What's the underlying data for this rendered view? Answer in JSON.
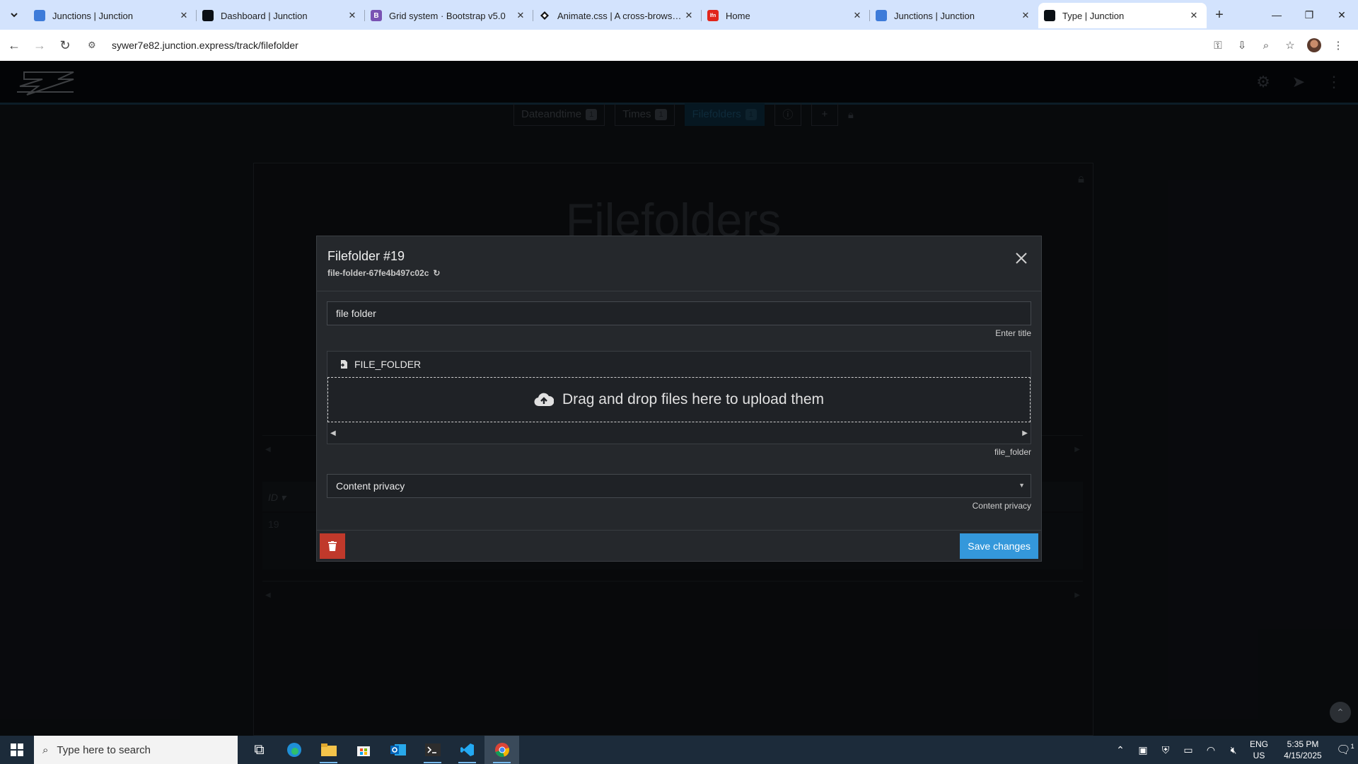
{
  "browser": {
    "tabs": [
      {
        "title": "Junctions | Junction",
        "fav_color": "#3d7bd9",
        "fav": ""
      },
      {
        "title": "Dashboard | Junction",
        "fav_color": "#0a0f14",
        "fav": ""
      },
      {
        "title": "Grid system · Bootstrap v5.0",
        "fav_color": "#7952b3",
        "fav": "B"
      },
      {
        "title": "Animate.css | A cross-browser library of CSS animations",
        "fav_color": "#111111",
        "fav": ""
      },
      {
        "title": "Home",
        "fav_color": "#e1251b",
        "fav": "lfn"
      },
      {
        "title": "Junctions | Junction",
        "fav_color": "#3d7bd9",
        "fav": ""
      },
      {
        "title": "Type | Junction",
        "fav_color": "#0a0f14",
        "fav": ""
      }
    ],
    "url": "sywer7e82.junction.express/track/filefolder"
  },
  "app": {
    "tabs": [
      {
        "label": "Dateandtime",
        "count": "1"
      },
      {
        "label": "Times",
        "count": "1"
      },
      {
        "label": "Filefolders",
        "count": "1"
      }
    ],
    "page_title": "Filefolders",
    "table": {
      "header_id": "ID",
      "row_id": "19"
    }
  },
  "modal": {
    "title": "Filefolder #19",
    "slug": "file-folder-67fe4b497c02c",
    "title_value": "file folder",
    "title_hint": "Enter title",
    "file_label": "FILE_FOLDER",
    "dropzone_text": "Drag and drop files here to upload them",
    "file_hint": "file_folder",
    "privacy_value": "Content privacy",
    "privacy_hint": "Content privacy",
    "save_label": "Save changes"
  },
  "taskbar": {
    "search_placeholder": "Type here to search",
    "lang_line1": "ENG",
    "lang_line2": "US",
    "time": "5:35 PM",
    "date": "4/15/2025",
    "notification_count": "1"
  },
  "colors": {
    "accent_blue": "#3498db",
    "danger_red": "#c0392b",
    "modal_bg": "#25282c"
  }
}
